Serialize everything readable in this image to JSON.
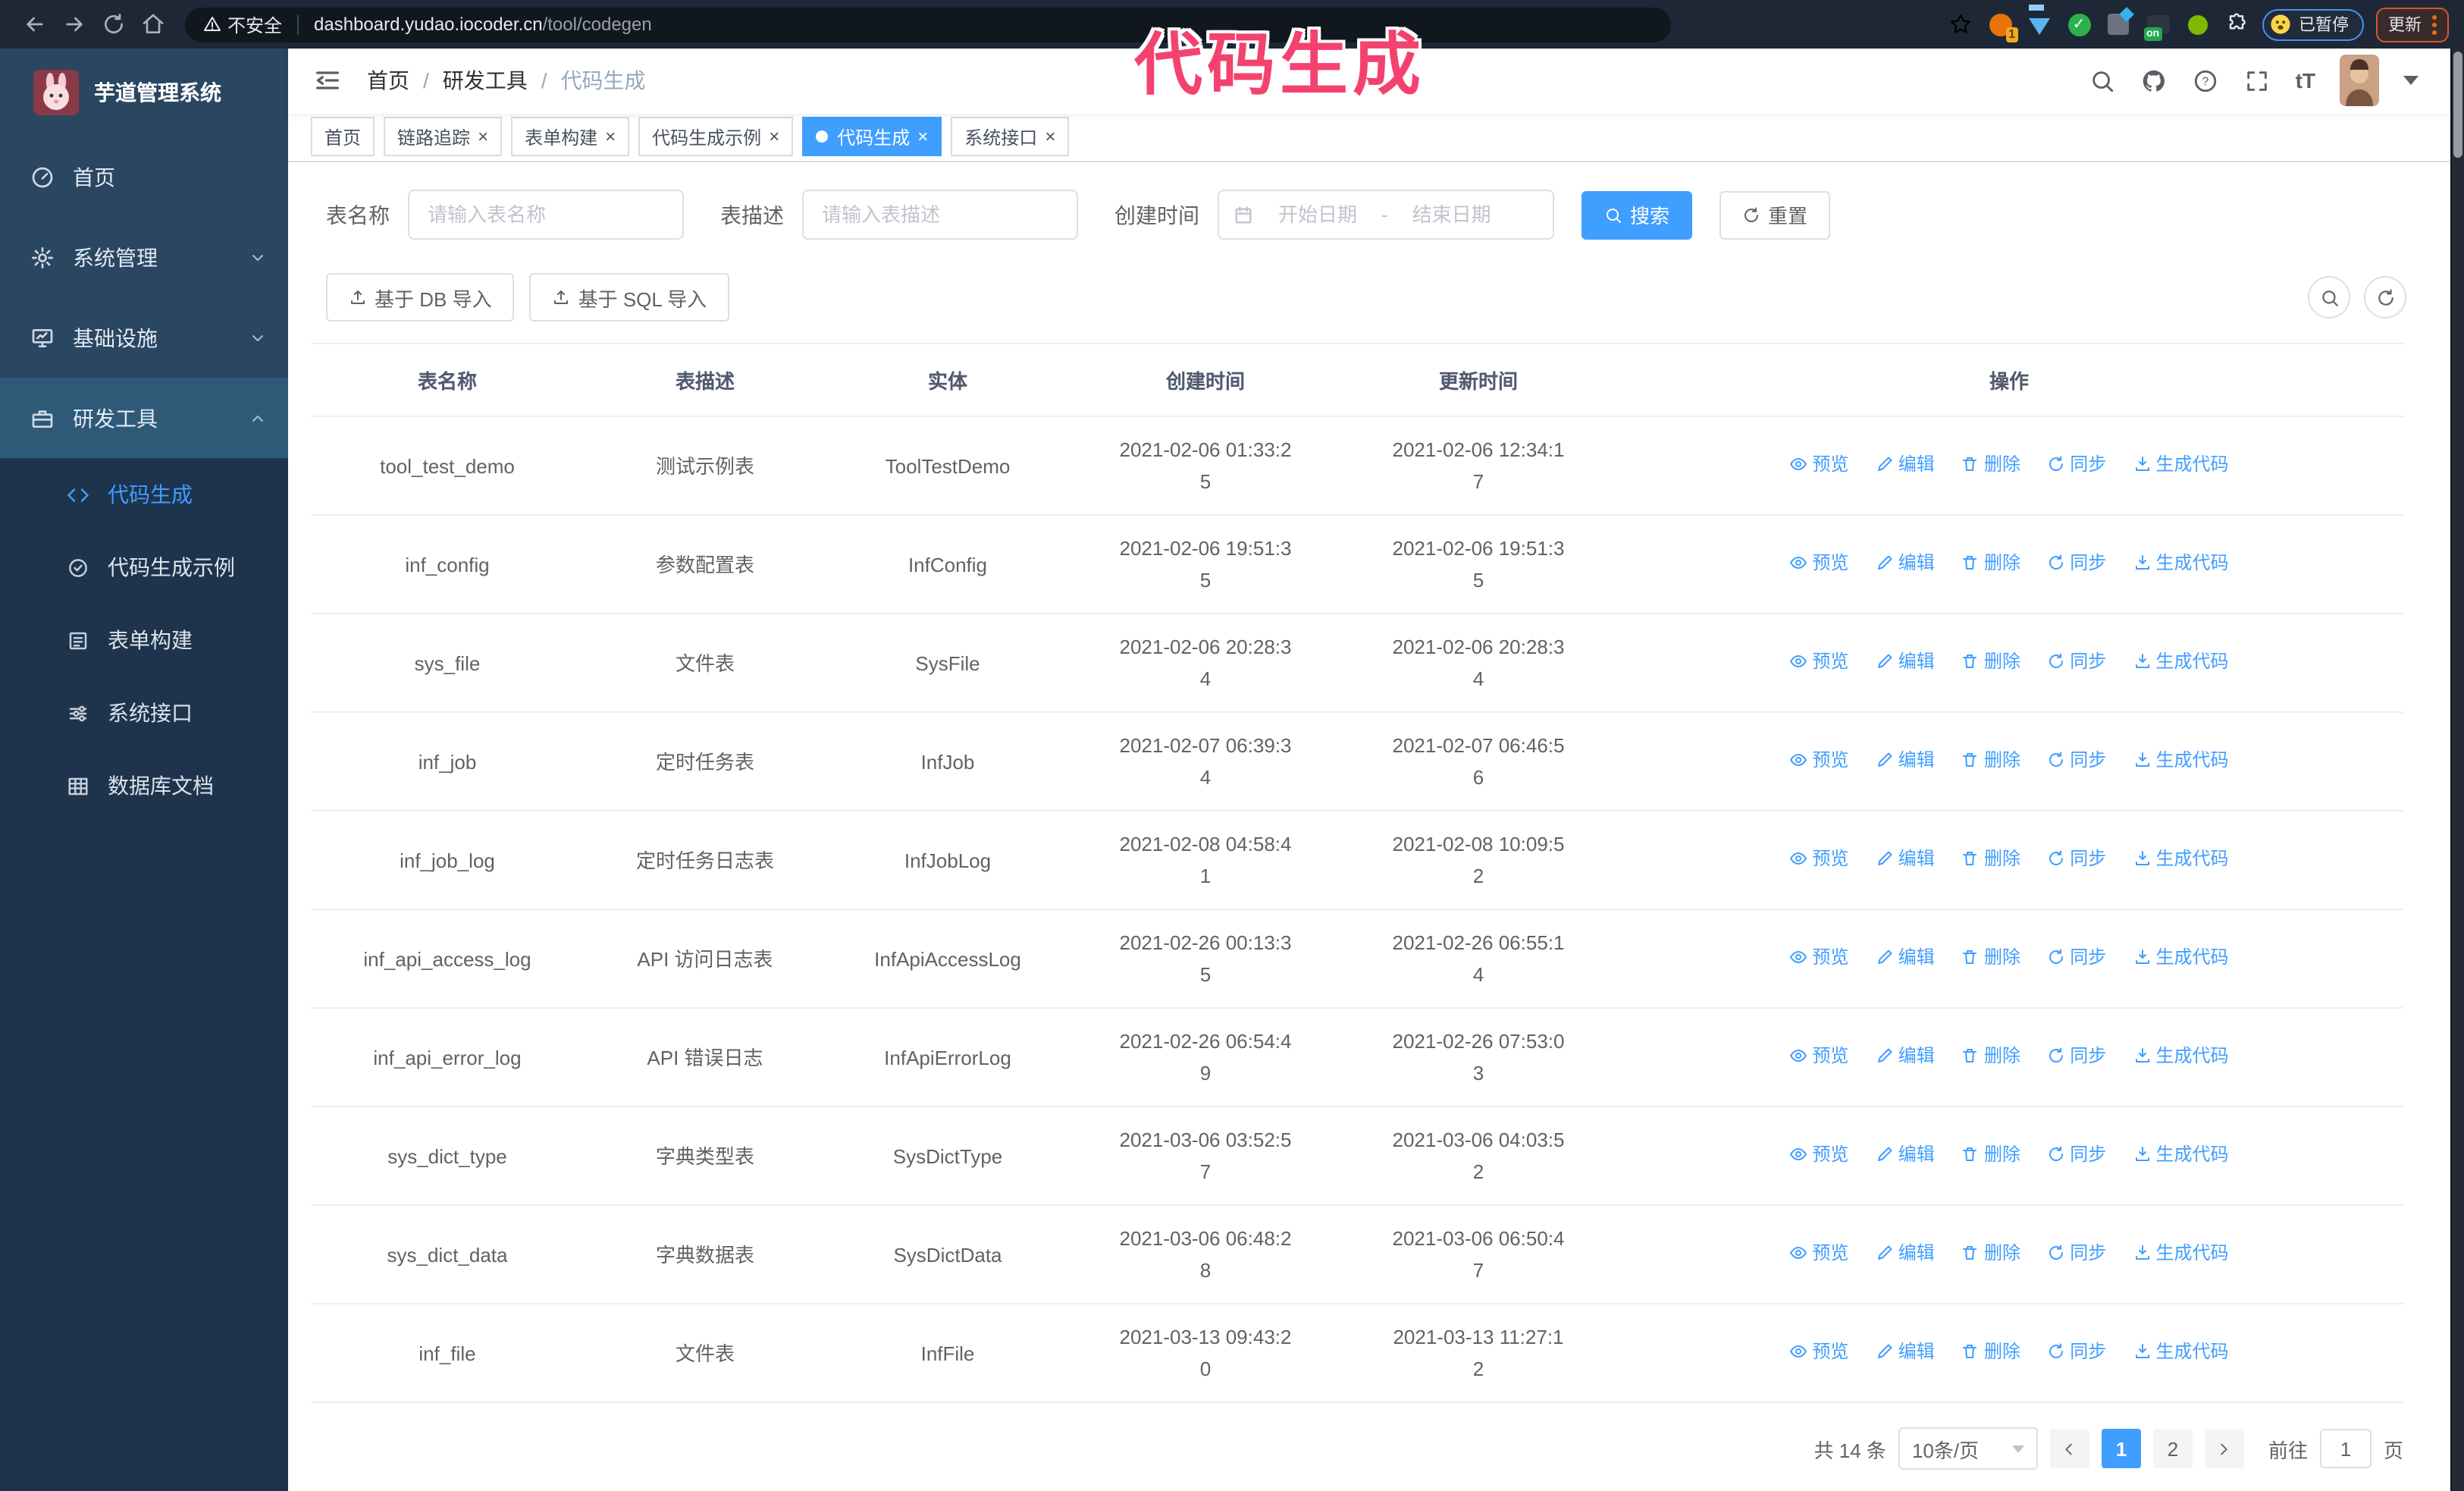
{
  "browser": {
    "security_label": "不安全",
    "url_host": "dashboard.yudao.iocoder.cn",
    "url_path": "/tool/codegen",
    "ext_badge": "1",
    "on_badge": "on",
    "paused_label": "已暂停",
    "update_label": "更新"
  },
  "annotation": {
    "text": "代码生成",
    "color": "#f4426e"
  },
  "sidebar": {
    "logo_title": "芋道管理系统",
    "items": [
      {
        "label": "首页",
        "icon": "dashboard-icon"
      },
      {
        "label": "系统管理",
        "icon": "gear-icon",
        "expand": "chevron-down"
      },
      {
        "label": "基础设施",
        "icon": "monitor-icon",
        "expand": "chevron-down"
      },
      {
        "label": "研发工具",
        "icon": "briefcase-icon",
        "expand": "chevron-up",
        "active": true
      }
    ],
    "subitems": [
      {
        "label": "代码生成",
        "icon": "code-icon",
        "active": true
      },
      {
        "label": "代码生成示例",
        "icon": "example-check-icon"
      },
      {
        "label": "表单构建",
        "icon": "form-icon"
      },
      {
        "label": "系统接口",
        "icon": "sliders-icon"
      },
      {
        "label": "数据库文档",
        "icon": "table-grid-icon"
      }
    ]
  },
  "navbar": {
    "breadcrumb": [
      "首页",
      "研发工具",
      "代码生成"
    ]
  },
  "tags": [
    {
      "label": "首页",
      "closable": false,
      "active": false
    },
    {
      "label": "链路追踪",
      "closable": true,
      "active": false
    },
    {
      "label": "表单构建",
      "closable": true,
      "active": false
    },
    {
      "label": "代码生成示例",
      "closable": true,
      "active": false
    },
    {
      "label": "代码生成",
      "closable": true,
      "active": true
    },
    {
      "label": "系统接口",
      "closable": true,
      "active": false
    }
  ],
  "search_form": {
    "name_label": "表名称",
    "name_placeholder": "请输入表名称",
    "desc_label": "表描述",
    "desc_placeholder": "请输入表描述",
    "time_label": "创建时间",
    "start_placeholder": "开始日期",
    "end_placeholder": "结束日期",
    "search_button": "搜索",
    "reset_button": "重置"
  },
  "toolbar": {
    "import_db": "基于 DB 导入",
    "import_sql": "基于 SQL 导入"
  },
  "table": {
    "columns": [
      "表名称",
      "表描述",
      "实体",
      "创建时间",
      "更新时间",
      "操作"
    ],
    "op_labels": {
      "preview": "预览",
      "edit": "编辑",
      "delete": "删除",
      "sync": "同步",
      "generate": "生成代码"
    },
    "rows": [
      {
        "name": "tool_test_demo",
        "desc": "测试示例表",
        "entity": "ToolTestDemo",
        "created": "2021-02-06 01:33:25",
        "updated": "2021-02-06 12:34:17"
      },
      {
        "name": "inf_config",
        "desc": "参数配置表",
        "entity": "InfConfig",
        "created": "2021-02-06 19:51:35",
        "updated": "2021-02-06 19:51:35"
      },
      {
        "name": "sys_file",
        "desc": "文件表",
        "entity": "SysFile",
        "created": "2021-02-06 20:28:34",
        "updated": "2021-02-06 20:28:34"
      },
      {
        "name": "inf_job",
        "desc": "定时任务表",
        "entity": "InfJob",
        "created": "2021-02-07 06:39:34",
        "updated": "2021-02-07 06:46:56"
      },
      {
        "name": "inf_job_log",
        "desc": "定时任务日志表",
        "entity": "InfJobLog",
        "created": "2021-02-08 04:58:41",
        "updated": "2021-02-08 10:09:52"
      },
      {
        "name": "inf_api_access_log",
        "desc": "API 访问日志表",
        "entity": "InfApiAccessLog",
        "created": "2021-02-26 00:13:35",
        "updated": "2021-02-26 06:55:14"
      },
      {
        "name": "inf_api_error_log",
        "desc": "API 错误日志",
        "entity": "InfApiErrorLog",
        "created": "2021-02-26 06:54:49",
        "updated": "2021-02-26 07:53:03"
      },
      {
        "name": "sys_dict_type",
        "desc": "字典类型表",
        "entity": "SysDictType",
        "created": "2021-03-06 03:52:57",
        "updated": "2021-03-06 04:03:52"
      },
      {
        "name": "sys_dict_data",
        "desc": "字典数据表",
        "entity": "SysDictData",
        "created": "2021-03-06 06:48:28",
        "updated": "2021-03-06 06:50:47"
      },
      {
        "name": "inf_file",
        "desc": "文件表",
        "entity": "InfFile",
        "created": "2021-03-13 09:43:20",
        "updated": "2021-03-13 11:27:12"
      }
    ]
  },
  "pagination": {
    "total": "共 14 条",
    "page_size": "10条/页",
    "pages": [
      "1",
      "2"
    ],
    "active_page": "1",
    "goto_label": "前往",
    "goto_value": "1",
    "page_suffix": "页"
  },
  "glyphs": {
    "breadcrumb_sep": "/",
    "tag_close": "×",
    "range_sep": "-",
    "question": "?",
    "font_size": "tT",
    "check": "✓"
  },
  "colors": {
    "accent": "#409EFF",
    "annotation_pink": "#f4426e",
    "sidebar_bg": "#2a4661",
    "sidebar_sub_bg": "#1e344d",
    "sidebar_active_parent_bg": "#2e5a78",
    "chrome_bg": "#1e2735",
    "update_border": "#d8552b",
    "paused_border": "#4b8df8",
    "table_border": "#ebeef5",
    "pager_bg": "#f4f4f5"
  }
}
